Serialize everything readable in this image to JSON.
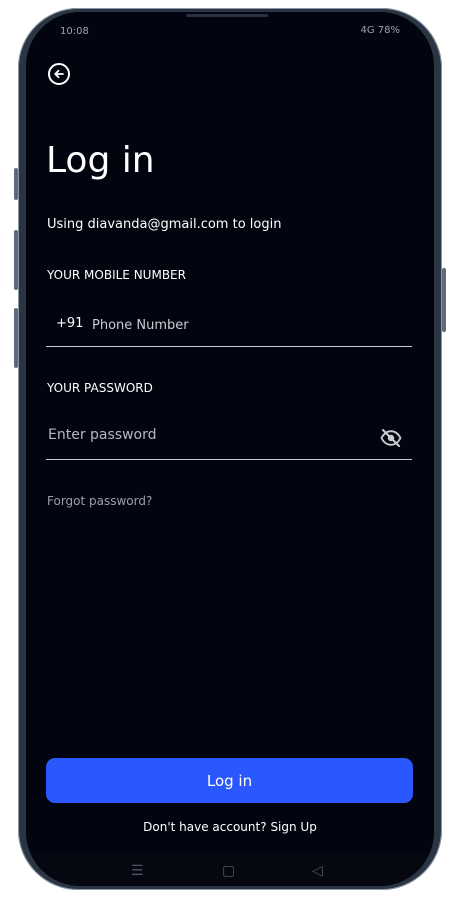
{
  "status_bar": {
    "time": "10:08",
    "right": "4G 78%"
  },
  "header": {
    "back_icon": "arrow-left-circle-icon",
    "title": "Log in"
  },
  "login_info": {
    "subtitle": "Using diavanda@gmail.com to login"
  },
  "phone": {
    "label": "YOUR MOBILE NUMBER",
    "prefix": "+91",
    "placeholder": "Phone Number",
    "value": ""
  },
  "password": {
    "label": "YOUR PASSWORD",
    "placeholder": "Enter password",
    "value": "",
    "toggle_icon": "eye-off-icon"
  },
  "links": {
    "forgot": "Forgot password?"
  },
  "actions": {
    "login_label": "Log in"
  },
  "signup": {
    "prompt": "Don't have account?",
    "link": "Sign Up"
  },
  "nav": {
    "menu_icon": "☰",
    "home_icon": "▢",
    "back_icon": "◁"
  },
  "colors": {
    "background": "#02050F",
    "accent": "#2B57FF",
    "text": "#FFFFFF",
    "muted": "#9AA0AA",
    "divider": "#C7CAD1"
  }
}
